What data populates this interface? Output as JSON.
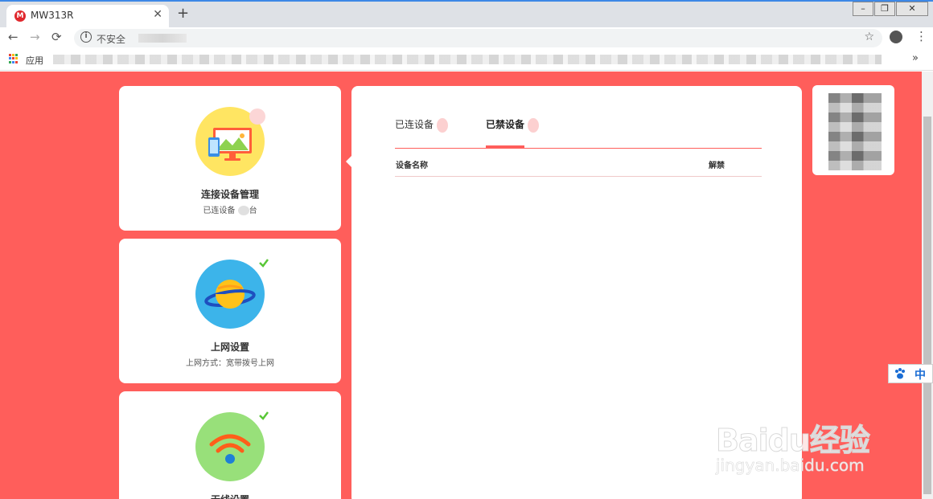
{
  "browser": {
    "tab_title": "MW313R",
    "tab_favicon": "M",
    "close_glyph": "✕",
    "newtab_glyph": "+",
    "back_glyph": "←",
    "forward_glyph": "→",
    "reload_glyph": "⟳",
    "insecure_label": "不安全",
    "info_glyph": "i",
    "star_glyph": "☆",
    "menu_glyph": "⋮",
    "apps_label": "应用",
    "more_glyph": "»",
    "win_min": "–",
    "win_max": "❐",
    "win_close": "✕",
    "accent": "#3d88e6"
  },
  "sidebar": {
    "cards": [
      {
        "title": "连接设备管理",
        "subtitle_prefix": "已连设备",
        "subtitle_suffix": "台",
        "icon": "monitor-phone-icon",
        "circle_color": "#ffe562"
      },
      {
        "title": "上网设置",
        "subtitle": "上网方式：宽带拨号上网",
        "icon": "planet-icon",
        "circle_color": "#3cb4ea"
      },
      {
        "title": "无线设置",
        "icon": "wifi-icon",
        "circle_color": "#98e07a"
      }
    ]
  },
  "panel": {
    "tabs": [
      {
        "label": "已连设备",
        "active": false
      },
      {
        "label": "已禁设备",
        "active": true
      }
    ],
    "columns": {
      "name": "设备名称",
      "action": "解禁"
    }
  },
  "theme": {
    "brand": "#ff5e5b",
    "check": "#59c737"
  },
  "ime": {
    "label": "中"
  },
  "watermark": {
    "main": "Baidu经验",
    "sub": "jingyan.baidu.com"
  }
}
